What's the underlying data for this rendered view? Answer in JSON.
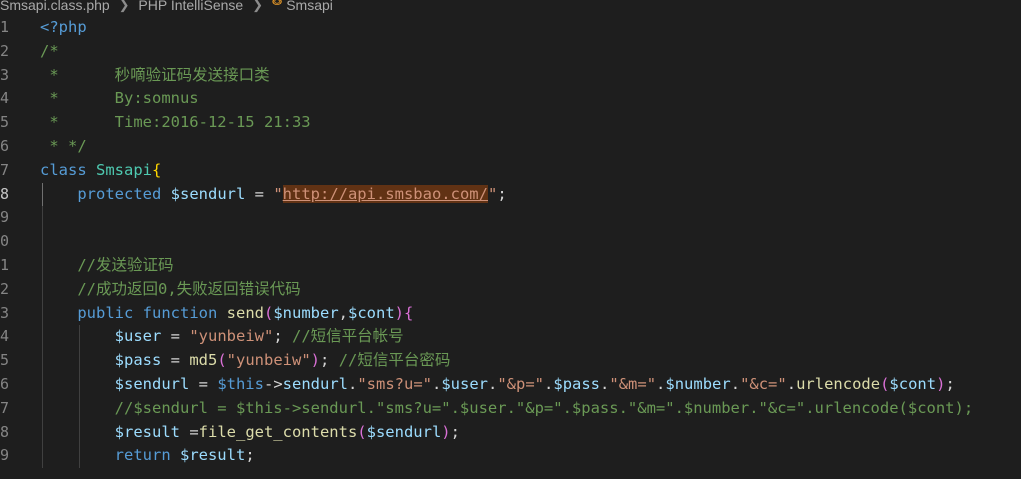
{
  "breadcrumb": {
    "file": "Smsapi.class.php",
    "section": "PHP IntelliSense",
    "symbol": "Smsapi",
    "symbol_icon": "class-icon"
  },
  "editor": {
    "lines": [
      {
        "num": "1",
        "tokens": [
          {
            "t": "<?php",
            "c": "t-php"
          }
        ]
      },
      {
        "num": "2",
        "tokens": [
          {
            "t": "/*",
            "c": "t-comment"
          }
        ]
      },
      {
        "num": "3",
        "tokens": [
          {
            "t": " *      秒嘀验证码发送接口类",
            "c": "t-comment"
          }
        ]
      },
      {
        "num": "4",
        "tokens": [
          {
            "t": " *      By:somnus",
            "c": "t-comment"
          }
        ]
      },
      {
        "num": "5",
        "tokens": [
          {
            "t": " *      Time:2016-12-15 21:33",
            "c": "t-comment"
          }
        ]
      },
      {
        "num": "6",
        "tokens": [
          {
            "t": " * */",
            "c": "t-comment"
          }
        ]
      },
      {
        "num": "7",
        "tokens": [
          {
            "t": "class ",
            "c": "t-kw"
          },
          {
            "t": "Smsapi",
            "c": "t-class"
          },
          {
            "t": "{",
            "c": "t-brace"
          }
        ]
      },
      {
        "num": "8",
        "tokens": [
          {
            "t": "    "
          },
          {
            "t": "protected ",
            "c": "t-kw"
          },
          {
            "t": "$sendurl",
            "c": "t-var"
          },
          {
            "t": " = ",
            "c": "t-plain"
          },
          {
            "t": "\"",
            "c": "t-str"
          },
          {
            "t": "http://api.smsbao.com/",
            "c": "t-sel"
          },
          {
            "t": "\"",
            "c": "t-str"
          },
          {
            "t": ";",
            "c": "t-plain"
          }
        ]
      },
      {
        "num": "9",
        "tokens": []
      },
      {
        "num": "0",
        "tokens": []
      },
      {
        "num": "1",
        "tokens": [
          {
            "t": "    "
          },
          {
            "t": "//发送验证码",
            "c": "t-comment"
          }
        ]
      },
      {
        "num": "2",
        "tokens": [
          {
            "t": "    "
          },
          {
            "t": "//成功返回0,失败返回错误代码",
            "c": "t-comment"
          }
        ]
      },
      {
        "num": "3",
        "tokens": [
          {
            "t": "    "
          },
          {
            "t": "public ",
            "c": "t-kw"
          },
          {
            "t": "function ",
            "c": "t-kw"
          },
          {
            "t": "send",
            "c": "t-fn"
          },
          {
            "t": "(",
            "c": "t-paren"
          },
          {
            "t": "$number",
            "c": "t-var"
          },
          {
            "t": ",",
            "c": "t-plain"
          },
          {
            "t": "$cont",
            "c": "t-var"
          },
          {
            "t": ")",
            "c": "t-paren"
          },
          {
            "t": "{",
            "c": "t-paren"
          }
        ]
      },
      {
        "num": "4",
        "tokens": [
          {
            "t": "        "
          },
          {
            "t": "$user",
            "c": "t-var"
          },
          {
            "t": " = ",
            "c": "t-plain"
          },
          {
            "t": "\"yunbeiw\"",
            "c": "t-str"
          },
          {
            "t": "; ",
            "c": "t-plain"
          },
          {
            "t": "//短信平台帐号",
            "c": "t-comment"
          }
        ]
      },
      {
        "num": "5",
        "tokens": [
          {
            "t": "        "
          },
          {
            "t": "$pass",
            "c": "t-var"
          },
          {
            "t": " = ",
            "c": "t-plain"
          },
          {
            "t": "md5",
            "c": "t-fn"
          },
          {
            "t": "(",
            "c": "t-paren"
          },
          {
            "t": "\"yunbeiw\"",
            "c": "t-str"
          },
          {
            "t": ")",
            "c": "t-paren"
          },
          {
            "t": "; ",
            "c": "t-plain"
          },
          {
            "t": "//短信平台密码",
            "c": "t-comment"
          }
        ]
      },
      {
        "num": "6",
        "tokens": [
          {
            "t": "        "
          },
          {
            "t": "$sendurl",
            "c": "t-var"
          },
          {
            "t": " = ",
            "c": "t-plain"
          },
          {
            "t": "$this",
            "c": "t-kw"
          },
          {
            "t": "->",
            "c": "t-plain"
          },
          {
            "t": "sendurl",
            "c": "t-var"
          },
          {
            "t": ".",
            "c": "t-plain"
          },
          {
            "t": "\"sms?u=\"",
            "c": "t-str"
          },
          {
            "t": ".",
            "c": "t-plain"
          },
          {
            "t": "$user",
            "c": "t-var"
          },
          {
            "t": ".",
            "c": "t-plain"
          },
          {
            "t": "\"&p=\"",
            "c": "t-str"
          },
          {
            "t": ".",
            "c": "t-plain"
          },
          {
            "t": "$pass",
            "c": "t-var"
          },
          {
            "t": ".",
            "c": "t-plain"
          },
          {
            "t": "\"&m=\"",
            "c": "t-str"
          },
          {
            "t": ".",
            "c": "t-plain"
          },
          {
            "t": "$number",
            "c": "t-var"
          },
          {
            "t": ".",
            "c": "t-plain"
          },
          {
            "t": "\"&c=\"",
            "c": "t-str"
          },
          {
            "t": ".",
            "c": "t-plain"
          },
          {
            "t": "urlencode",
            "c": "t-fn"
          },
          {
            "t": "(",
            "c": "t-paren"
          },
          {
            "t": "$cont",
            "c": "t-var"
          },
          {
            "t": ")",
            "c": "t-paren"
          },
          {
            "t": ";",
            "c": "t-plain"
          }
        ]
      },
      {
        "num": "7",
        "tokens": [
          {
            "t": "        "
          },
          {
            "t": "//$sendurl = $this->sendurl.\"sms?u=\".$user.\"&p=\".$pass.\"&m=\".$number.\"&c=\".urlencode($cont);",
            "c": "t-comment"
          }
        ]
      },
      {
        "num": "8",
        "tokens": [
          {
            "t": "        "
          },
          {
            "t": "$result",
            "c": "t-var"
          },
          {
            "t": " =",
            "c": "t-plain"
          },
          {
            "t": "file_get_contents",
            "c": "t-fn"
          },
          {
            "t": "(",
            "c": "t-paren"
          },
          {
            "t": "$sendurl",
            "c": "t-var"
          },
          {
            "t": ")",
            "c": "t-paren"
          },
          {
            "t": ";",
            "c": "t-plain"
          }
        ]
      },
      {
        "num": "9",
        "tokens": [
          {
            "t": "        "
          },
          {
            "t": "return ",
            "c": "t-kw"
          },
          {
            "t": "$result",
            "c": "t-var"
          },
          {
            "t": ";",
            "c": "t-plain"
          }
        ]
      }
    ]
  },
  "colors": {
    "background": "#1e1e1e",
    "keyword": "#569cd6",
    "comment": "#6a9955",
    "string": "#ce9178",
    "variable": "#9cdcfe",
    "function": "#dcdcaa",
    "class": "#4ec9b0",
    "selection": "#613214"
  }
}
